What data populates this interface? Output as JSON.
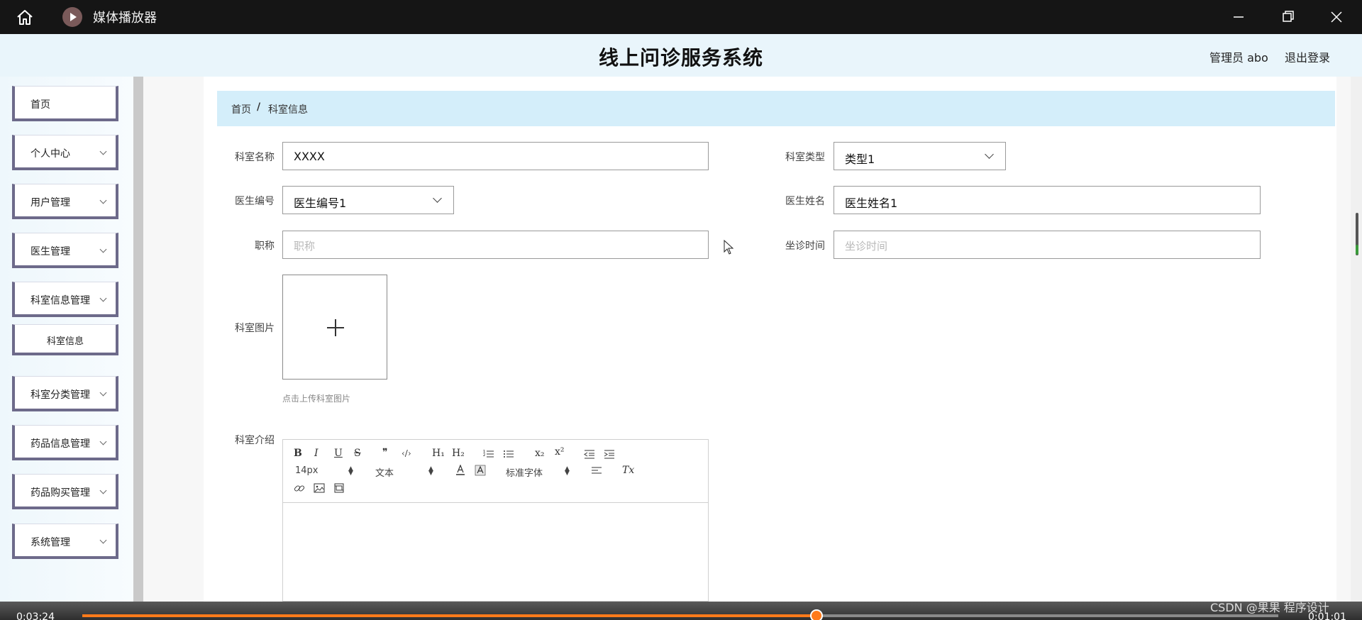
{
  "player": {
    "title": "媒体播放器",
    "time_elapsed": "0:03:24",
    "time_total": "0:01:01",
    "progress_fraction": 0.614,
    "watermark": "CSDN @果果 程序设计"
  },
  "header": {
    "title": "线上问诊服务系统",
    "user": "管理员 abo",
    "logout": "退出登录"
  },
  "sidebar": {
    "items": [
      {
        "label": "首页"
      },
      {
        "label": "个人中心"
      },
      {
        "label": "用户管理"
      },
      {
        "label": "医生管理"
      },
      {
        "label": "科室信息管理"
      },
      {
        "label": "科室信息"
      },
      {
        "label": "科室分类管理"
      },
      {
        "label": "药品信息管理"
      },
      {
        "label": "药品购买管理"
      },
      {
        "label": "系统管理"
      }
    ]
  },
  "breadcrumb": {
    "home": "首页",
    "separator": "/",
    "current": "科室信息"
  },
  "form": {
    "dept_name": {
      "label": "科室名称",
      "value": "XXXX"
    },
    "dept_type": {
      "label": "科室类型",
      "value": "类型1"
    },
    "doctor_no": {
      "label": "医生编号",
      "value": "医生编号1"
    },
    "doctor_name": {
      "label": "医生姓名",
      "value": "医生姓名1"
    },
    "title": {
      "label": "职称",
      "placeholder": "职称"
    },
    "clinic_time": {
      "label": "坐诊时间",
      "placeholder": "坐诊时间"
    },
    "image": {
      "label": "科室图片",
      "hint": "点击上传科室图片"
    },
    "intro": {
      "label": "科室介绍"
    }
  },
  "editor": {
    "bold": "B",
    "italic": "I",
    "underline": "U",
    "strike": "S",
    "quote": "❞",
    "code": "‹/›",
    "h1": "H₁",
    "h2": "H₂",
    "sub": "x₂",
    "sup": "x²",
    "font_size": "14px",
    "paragraph": "文本",
    "font_family": "标准字体",
    "clear": "Tx"
  },
  "colors": {
    "accent": "#6d6a8a",
    "header_bg": "#e9f5fb",
    "breadcrumb_bg": "#d4eefa",
    "progress": "#ff7a1a"
  }
}
